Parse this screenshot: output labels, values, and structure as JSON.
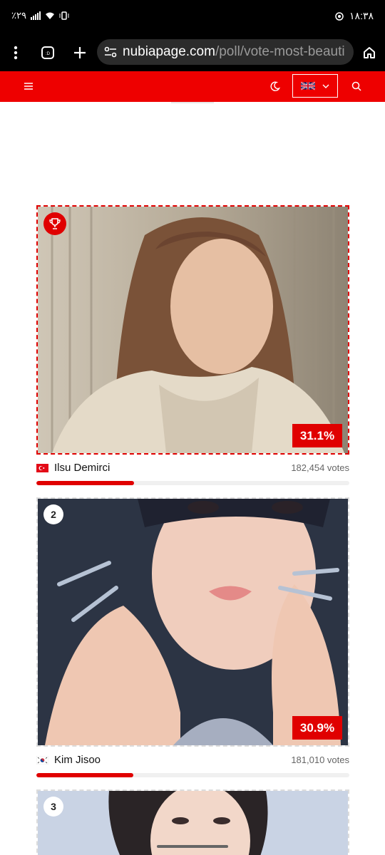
{
  "status_bar": {
    "battery": "٪۲۹",
    "time": "۱۸:۳۸"
  },
  "browser": {
    "url_domain": "nubiapage.com",
    "url_path": "/poll/vote-most-beauti",
    "icons": [
      "menu-dots-icon",
      "tabs-icon",
      "plus-icon",
      "site-settings-icon",
      "home-icon"
    ]
  },
  "header": {
    "background": "#ee0000",
    "language": "English (UK flag)",
    "icons": [
      "hamburger-icon",
      "moon-icon",
      "uk-flag-icon",
      "chevron-down-icon",
      "search-icon"
    ]
  },
  "poll": {
    "accent": "#e00000",
    "entries": [
      {
        "rank": "1",
        "name": "Ilsu Demirci",
        "country": "Turkey",
        "votes": "182,454 votes",
        "percent": "31.1%",
        "share": 0.311,
        "winner": true
      },
      {
        "rank": "2",
        "name": "Kim Jisoo",
        "country": "South Korea",
        "votes": "181,010 votes",
        "percent": "30.9%",
        "share": 0.309,
        "winner": false
      },
      {
        "rank": "3",
        "name": "",
        "country": "",
        "votes": "",
        "percent": "",
        "share": 0,
        "winner": false
      }
    ]
  }
}
